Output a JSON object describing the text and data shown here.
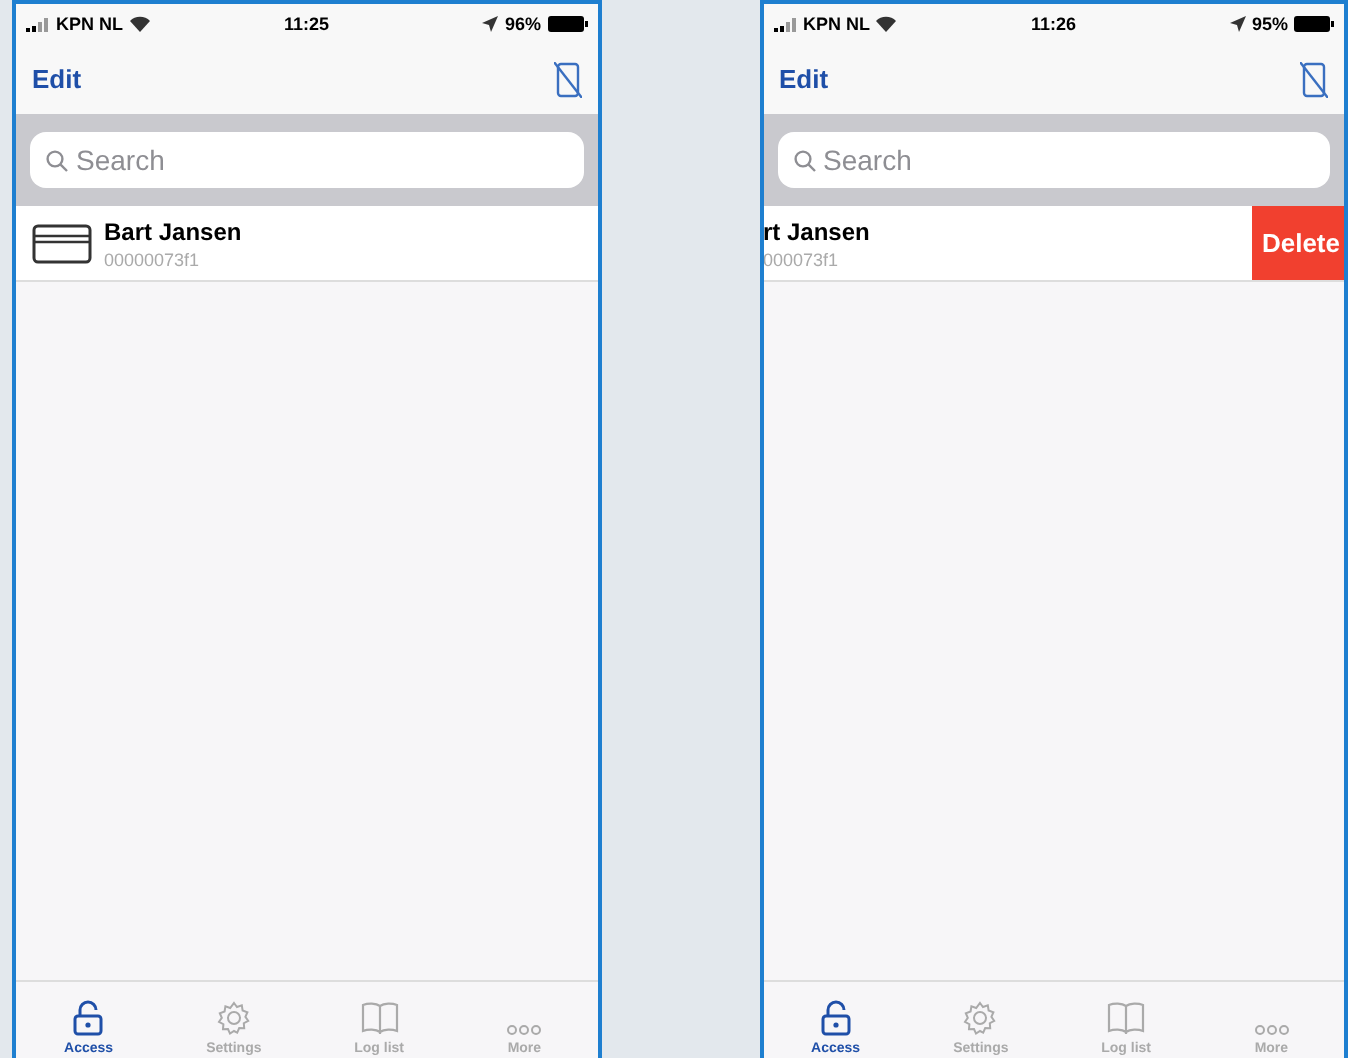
{
  "phones": [
    {
      "status_bar": {
        "carrier": "KPN NL",
        "time": "11:25",
        "battery": "96%"
      },
      "nav": {
        "edit": "Edit"
      },
      "search": {
        "placeholder": "Search"
      },
      "rows": [
        {
          "name": "Bart Jansen",
          "id": "00000073f1",
          "swiped": false
        }
      ],
      "tabs": [
        {
          "label": "Access",
          "selected": true
        },
        {
          "label": "Settings",
          "selected": false
        },
        {
          "label": "Log list",
          "selected": false
        },
        {
          "label": "More",
          "selected": false
        }
      ]
    },
    {
      "status_bar": {
        "carrier": "KPN NL",
        "time": "11:26",
        "battery": "95%"
      },
      "nav": {
        "edit": "Edit"
      },
      "search": {
        "placeholder": "Search"
      },
      "rows": [
        {
          "name": "rt Jansen",
          "id": "000073f1",
          "swiped": true,
          "delete_label": "Delete"
        }
      ],
      "tabs": [
        {
          "label": "Access",
          "selected": true
        },
        {
          "label": "Settings",
          "selected": false
        },
        {
          "label": "Log list",
          "selected": false
        },
        {
          "label": "More",
          "selected": false
        }
      ]
    }
  ]
}
